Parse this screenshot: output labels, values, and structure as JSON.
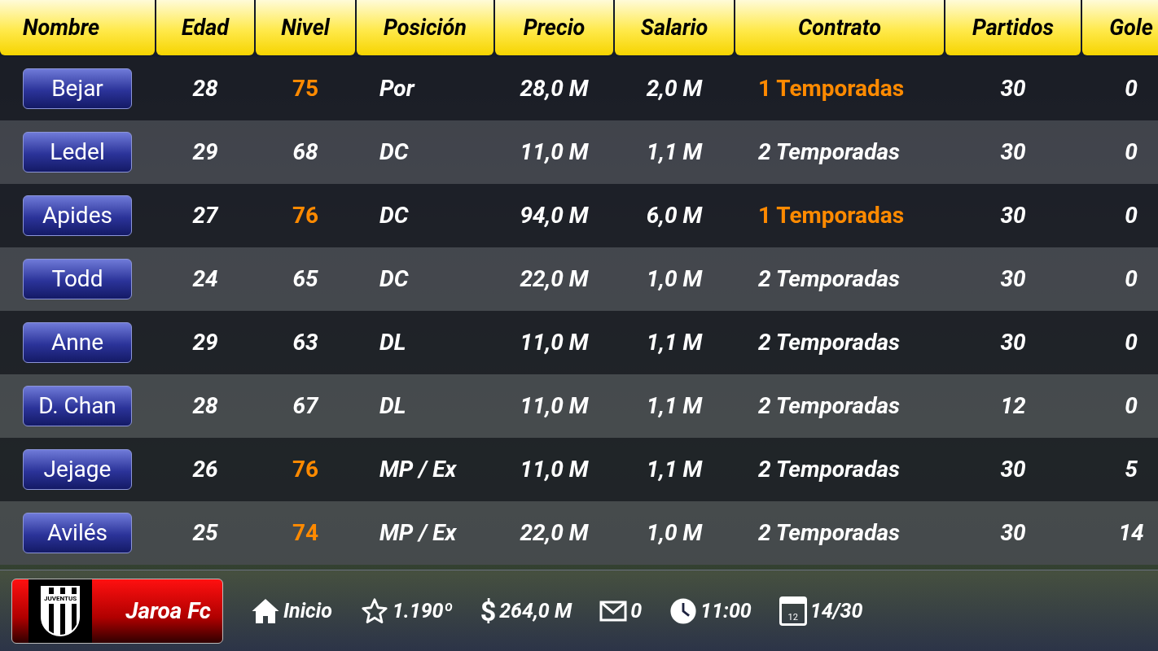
{
  "columns": [
    "Nombre",
    "Edad",
    "Nivel",
    "Posición",
    "Precio",
    "Salario",
    "Contrato",
    "Partidos",
    "Gole"
  ],
  "rows": [
    {
      "name": "Bejar",
      "age": "28",
      "level": "75",
      "level_highlight": true,
      "position": "Por",
      "price": "28,0 M",
      "salary": "2,0 M",
      "contract": "1 Temporadas",
      "contract_highlight": true,
      "matches": "30",
      "goals": "0"
    },
    {
      "name": "Ledel",
      "age": "29",
      "level": "68",
      "level_highlight": false,
      "position": "DC",
      "price": "11,0 M",
      "salary": "1,1 M",
      "contract": "2 Temporadas",
      "contract_highlight": false,
      "matches": "30",
      "goals": "0"
    },
    {
      "name": "Apides",
      "age": "27",
      "level": "76",
      "level_highlight": true,
      "position": "DC",
      "price": "94,0 M",
      "salary": "6,0 M",
      "contract": "1 Temporadas",
      "contract_highlight": true,
      "matches": "30",
      "goals": "0"
    },
    {
      "name": "Todd",
      "age": "24",
      "level": "65",
      "level_highlight": false,
      "position": "DC",
      "price": "22,0 M",
      "salary": "1,0 M",
      "contract": "2 Temporadas",
      "contract_highlight": false,
      "matches": "30",
      "goals": "0"
    },
    {
      "name": "Anne",
      "age": "29",
      "level": "63",
      "level_highlight": false,
      "position": "DL",
      "price": "11,0 M",
      "salary": "1,1 M",
      "contract": "2 Temporadas",
      "contract_highlight": false,
      "matches": "30",
      "goals": "0"
    },
    {
      "name": "D. Chan",
      "age": "28",
      "level": "67",
      "level_highlight": false,
      "position": "DL",
      "price": "11,0 M",
      "salary": "1,1 M",
      "contract": "2 Temporadas",
      "contract_highlight": false,
      "matches": "12",
      "goals": "0"
    },
    {
      "name": "Jejage",
      "age": "26",
      "level": "76",
      "level_highlight": true,
      "position": "MP / Ex",
      "price": "11,0 M",
      "salary": "1,1 M",
      "contract": "2 Temporadas",
      "contract_highlight": false,
      "matches": "30",
      "goals": "5"
    },
    {
      "name": "Avilés",
      "age": "25",
      "level": "74",
      "level_highlight": true,
      "position": "MP / Ex",
      "price": "22,0 M",
      "salary": "1,0 M",
      "contract": "2 Temporadas",
      "contract_highlight": false,
      "matches": "30",
      "goals": "14"
    }
  ],
  "team": {
    "crest_text": "JUVENTUS",
    "name": "Jaroa Fc"
  },
  "status_bar": [
    {
      "kind": "home",
      "text": "Inicio"
    },
    {
      "kind": "rank",
      "text": "1.190º"
    },
    {
      "kind": "money",
      "text": "264,0 M",
      "icon_text": "$"
    },
    {
      "kind": "mail",
      "text": "0"
    },
    {
      "kind": "time",
      "text": "11:00"
    },
    {
      "kind": "calendar",
      "text": "14/30",
      "icon_text": "12"
    }
  ]
}
